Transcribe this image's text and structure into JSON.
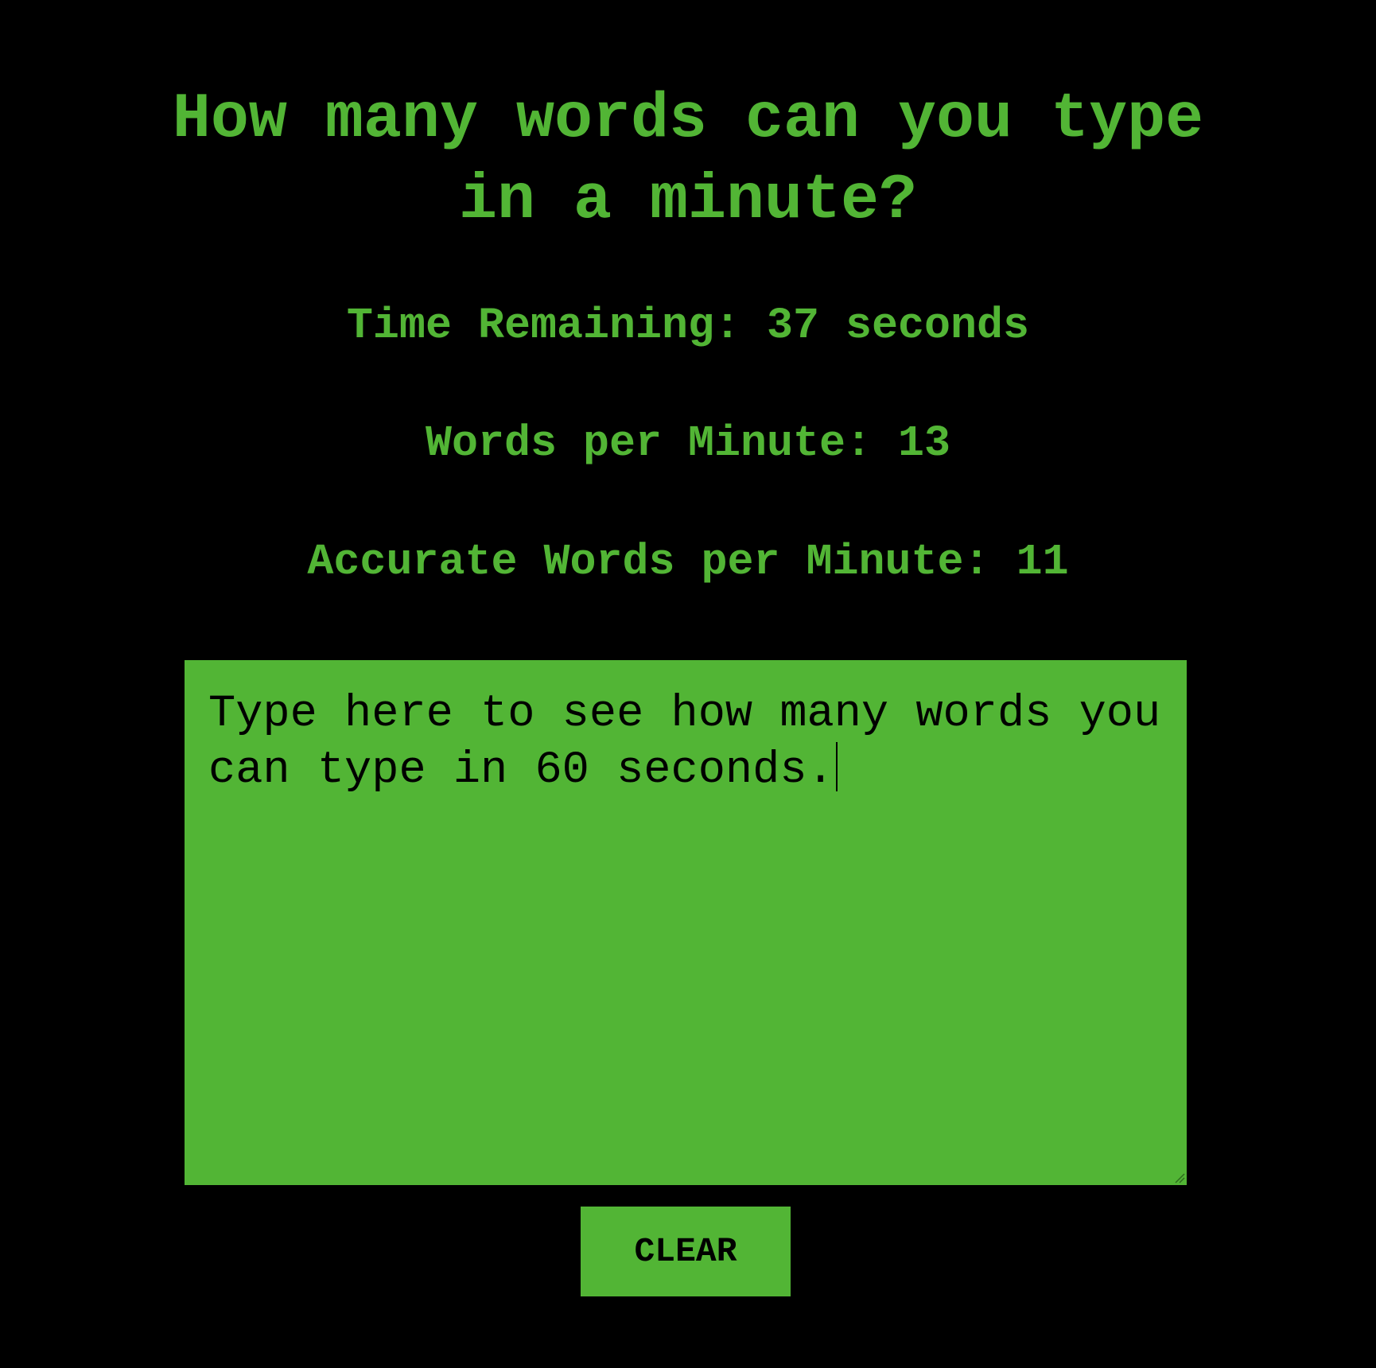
{
  "page": {
    "title_line1": "How many words can you type",
    "title_line2": "in a minute?"
  },
  "stats": {
    "time_remaining": "Time Remaining: 37 seconds",
    "words_per_minute": "Words per Minute: 13",
    "accurate_words_per_minute": "Accurate Words per Minute: 11"
  },
  "typing_area": {
    "value": "Type here to see how many words you can type in 60 seconds."
  },
  "buttons": {
    "clear_label": "CLEAR"
  },
  "colors": {
    "background": "#000000",
    "accent": "#52b535",
    "text_on_accent": "#000000"
  }
}
